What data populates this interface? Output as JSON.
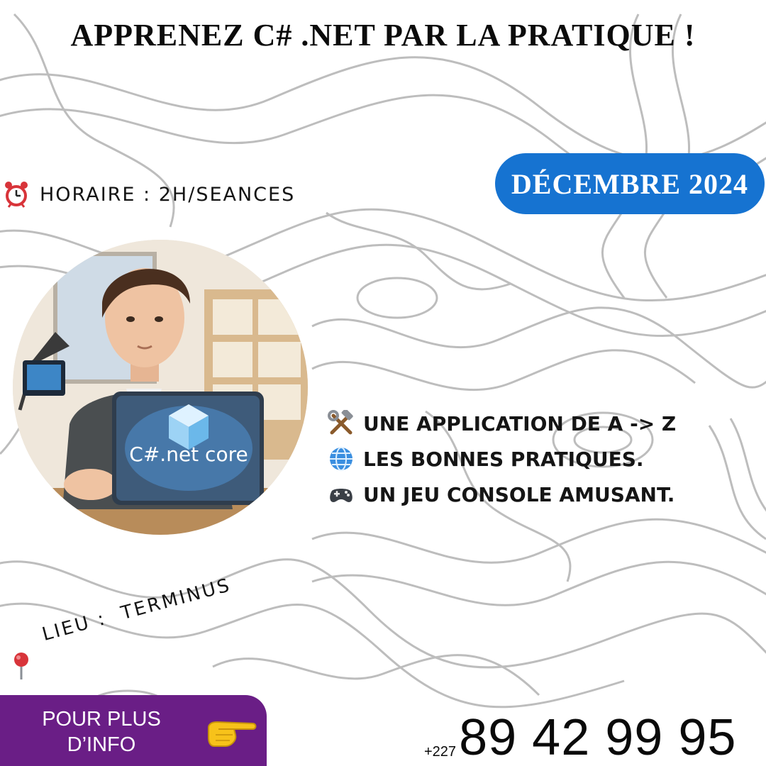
{
  "title": "APPRENEZ C# .NET PAR LA PRATIQUE !",
  "date_badge": "DÉCEMBRE 2024",
  "schedule": {
    "icon": "alarm-clock-icon",
    "text": "HORAIRE : 2H/SEANCES"
  },
  "illustration": {
    "laptop_text": "C#.net core"
  },
  "features": [
    {
      "icon": "hammer-wrench-icon",
      "text": "UNE APPLICATION DE A -> Z"
    },
    {
      "icon": "globe-icon",
      "text": "LES BONNES PRATIQUES."
    },
    {
      "icon": "gamepad-icon",
      "text": "UN JEU CONSOLE AMUSANT."
    }
  ],
  "location": {
    "icon": "map-pin-icon",
    "text": "LIEU :  TERMINUS"
  },
  "cta": {
    "label_line1": "POUR PLUS",
    "label_line2": "D’INFO",
    "icon": "pointing-hand-icon"
  },
  "phone": {
    "prefix": "+227",
    "number": "89 42 99 95"
  },
  "colors": {
    "accent_blue": "#1673d1",
    "cta_purple": "#6a1e86",
    "pin_red": "#d8343a"
  }
}
